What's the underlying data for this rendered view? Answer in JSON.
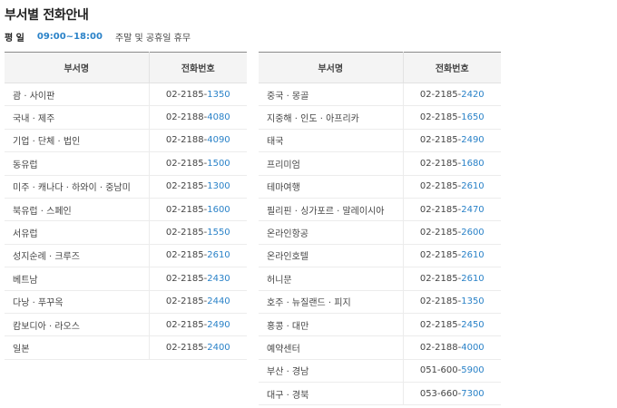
{
  "page": {
    "title": "부서별 전화안내",
    "hours_label": "평 일",
    "hours_time": "09:00~18:00",
    "hours_note": "주말 및 공휴일 휴무"
  },
  "table_headers": {
    "department": "부서명",
    "phone": "전화번호"
  },
  "left_table": [
    {
      "dept": "괌 · 사이판",
      "prefix": "02-2185-",
      "ext": "1350"
    },
    {
      "dept": "국내 · 제주",
      "prefix": "02-2188-",
      "ext": "4080"
    },
    {
      "dept": "기업 · 단체 · 법인",
      "prefix": "02-2188-",
      "ext": "4090"
    },
    {
      "dept": "동유럽",
      "prefix": "02-2185-",
      "ext": "1500"
    },
    {
      "dept": "미주 · 캐나다 · 하와이 · 중남미",
      "prefix": "02-2185-",
      "ext": "1300"
    },
    {
      "dept": "북유럽 · 스페인",
      "prefix": "02-2185-",
      "ext": "1600"
    },
    {
      "dept": "서유럽",
      "prefix": "02-2185-",
      "ext": "1550"
    },
    {
      "dept": "성지순례 · 크루즈",
      "prefix": "02-2185-",
      "ext": "2610"
    },
    {
      "dept": "베트남",
      "prefix": "02-2185-",
      "ext": "2430"
    },
    {
      "dept": "다낭 · 푸꾸옥",
      "prefix": "02-2185-",
      "ext": "2440"
    },
    {
      "dept": "캄보디아 · 라오스",
      "prefix": "02-2185-",
      "ext": "2490"
    },
    {
      "dept": "일본",
      "prefix": "02-2185-",
      "ext": "2400"
    }
  ],
  "right_table": [
    {
      "dept": "중국 · 몽골",
      "prefix": "02-2185-",
      "ext": "2420"
    },
    {
      "dept": "지중해 · 인도 · 아프리카",
      "prefix": "02-2185-",
      "ext": "1650"
    },
    {
      "dept": "태국",
      "prefix": "02-2185-",
      "ext": "2490"
    },
    {
      "dept": "프리미엄",
      "prefix": "02-2185-",
      "ext": "1680"
    },
    {
      "dept": "테마여행",
      "prefix": "02-2185-",
      "ext": "2610"
    },
    {
      "dept": "필리핀 · 싱가포르 · 말레이시아",
      "prefix": "02-2185-",
      "ext": "2470"
    },
    {
      "dept": "온라인항공",
      "prefix": "02-2185-",
      "ext": "2600"
    },
    {
      "dept": "온라인호텔",
      "prefix": "02-2185-",
      "ext": "2610"
    },
    {
      "dept": "허니문",
      "prefix": "02-2185-",
      "ext": "2610"
    },
    {
      "dept": "호주 · 뉴질랜드 · 피지",
      "prefix": "02-2185-",
      "ext": "1350"
    },
    {
      "dept": "홍콩 · 대만",
      "prefix": "02-2185-",
      "ext": "2450"
    },
    {
      "dept": "예약센터",
      "prefix": "02-2188-",
      "ext": "4000"
    },
    {
      "dept": "부산 · 경남",
      "prefix": "051-600-",
      "ext": "5900"
    },
    {
      "dept": "대구 · 경북",
      "prefix": "053-660-",
      "ext": "7300"
    }
  ],
  "colors": {
    "accent": "#2a82c8",
    "text": "#444444",
    "header_bg": "#f4f4f4"
  }
}
